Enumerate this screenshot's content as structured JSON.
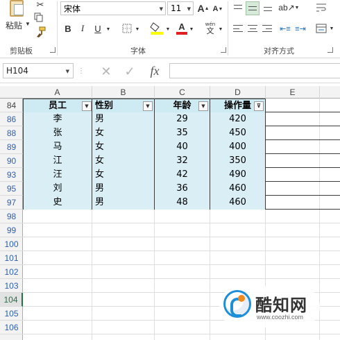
{
  "ribbon": {
    "clipboard": {
      "paste_label": "粘贴",
      "group_label": "剪贴板"
    },
    "font": {
      "font_name": "宋体",
      "font_size": "11",
      "grow_label": "A",
      "shrink_label": "A",
      "bold_label": "B",
      "italic_label": "I",
      "underline_label": "U",
      "phonetic_label": "wén",
      "phonetic_char": "文",
      "group_label": "字体",
      "fill_color": "#FFFF00",
      "font_color": "#E02020"
    },
    "alignment": {
      "group_label": "对齐方式"
    }
  },
  "formula_bar": {
    "name_box": "H104",
    "cancel_symbol": "✕",
    "enter_symbol": "✓",
    "fx_label": "fx",
    "formula": ""
  },
  "sheet": {
    "columns": [
      "A",
      "B",
      "C",
      "D",
      "E"
    ],
    "rows": [
      "84",
      "86",
      "88",
      "89",
      "90",
      "93",
      "95",
      "97",
      "98",
      "99",
      "100",
      "101",
      "102",
      "103",
      "104",
      "105",
      "106"
    ],
    "header_row": {
      "row": "84",
      "cells": [
        "员工",
        "性别",
        "年龄",
        "操作量"
      ]
    },
    "data_rows": [
      {
        "row": "86",
        "name": "李",
        "gender": "男",
        "age": "29",
        "amount": "420"
      },
      {
        "row": "88",
        "name": "张",
        "gender": "女",
        "age": "35",
        "amount": "450"
      },
      {
        "row": "89",
        "name": "马",
        "gender": "女",
        "age": "40",
        "amount": "400"
      },
      {
        "row": "90",
        "name": "江",
        "gender": "女",
        "age": "32",
        "amount": "350"
      },
      {
        "row": "93",
        "name": "汪",
        "gender": "女",
        "age": "42",
        "amount": "490"
      },
      {
        "row": "95",
        "name": "刘",
        "gender": "男",
        "age": "36",
        "amount": "460"
      },
      {
        "row": "97",
        "name": "史",
        "gender": "男",
        "age": "48",
        "amount": "460"
      }
    ],
    "selected_row": "104"
  },
  "watermark": {
    "name": "酷知网",
    "url": "www.coozhi.com"
  }
}
